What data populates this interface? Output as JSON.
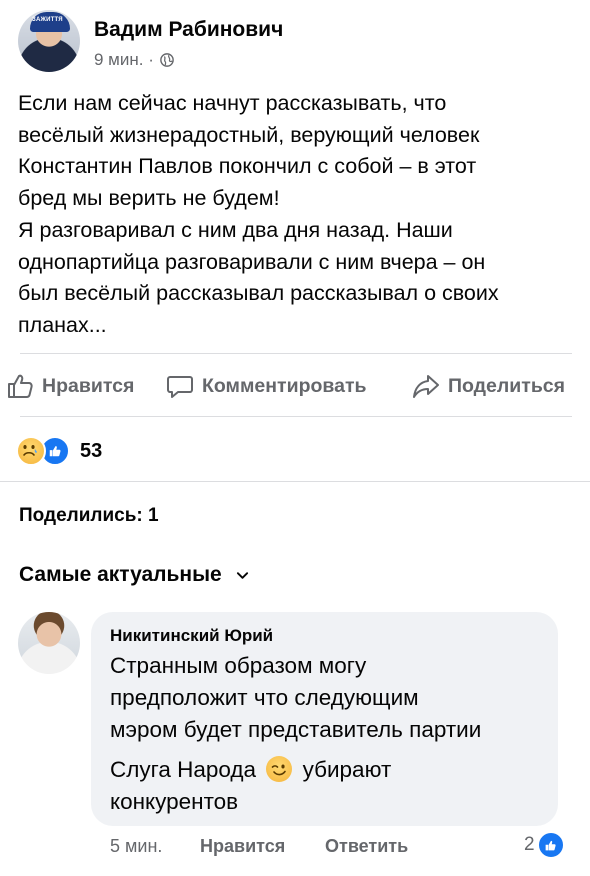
{
  "post": {
    "author": "Вадим Рабинович",
    "time": "9 мин. ·",
    "avatar_cap_text": "ЗАЖИТТЯ",
    "lines": [
      "Если нам сейчас начнут рассказывать, что",
      "весёлый жизнерадостный, верующий человек",
      "Константин Павлов покончил с собой – в этот",
      "бред мы верить не будем!",
      "Я разговаривал с ним два дня назад. Наши",
      "однопартийца разговаривали с ним вчера – он",
      "был весёлый рассказывал рассказывал о своих",
      "планах..."
    ]
  },
  "actions": {
    "like": "Нравится",
    "comment": "Комментировать",
    "share": "Поделиться"
  },
  "reactions": {
    "count": "53",
    "icons": [
      "sad-emoji-icon",
      "like-reaction-icon"
    ]
  },
  "shares_text": "Поделились: 1",
  "sort_label": "Самые актуальные",
  "comment": {
    "author": "Никитинский Юрий",
    "lines": [
      "Странным образом могу",
      "предположит что следующим",
      "мэром будет представитель партии"
    ],
    "line4_before": "Слуга Народа",
    "line4_after": "убирают",
    "line5": "конкурентов",
    "time": "5 мин.",
    "like": "Нравится",
    "reply": "Ответить",
    "reaction_count": "2"
  },
  "colors": {
    "accent": "#1877f2",
    "secondary_text": "#65676b",
    "bubble": "#f0f2f5"
  }
}
